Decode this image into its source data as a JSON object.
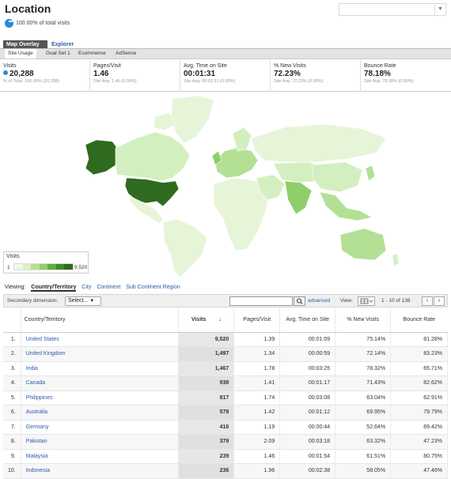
{
  "header": {
    "title": "Location",
    "subtitle": "100.00% of total visits"
  },
  "tabs": [
    {
      "label": "Map Overlay",
      "active": true
    },
    {
      "label": "Explorer",
      "active": false
    }
  ],
  "subtabs": [
    {
      "label": "Site Usage",
      "active": true
    },
    {
      "label": "Goal Set 1",
      "active": false
    },
    {
      "label": "Ecommerce",
      "active": false
    },
    {
      "label": "AdSense",
      "active": false
    }
  ],
  "metrics": [
    {
      "label": "Visits",
      "value": "20,288",
      "sub": "% of Total: 100.00% (20,288)"
    },
    {
      "label": "Pages/Visit",
      "value": "1.46",
      "sub": "Site Avg: 1.46 (0.00%)"
    },
    {
      "label": "Avg. Time on Site",
      "value": "00:01:31",
      "sub": "Site Avg: 00:01:31 (0.00%)"
    },
    {
      "label": "% New Visits",
      "value": "72.23%",
      "sub": "Site Avg: 72.23% (0.00%)"
    },
    {
      "label": "Bounce Rate",
      "value": "78.18%",
      "sub": "Site Avg: 78.18% (0.00%)"
    }
  ],
  "legend": {
    "title": "Visits",
    "min": "1",
    "max": "9,520"
  },
  "colors": {
    "map_dark": "#2e6b1e",
    "map_mid": "#8fcf6a",
    "map_light": "#d9f0c4",
    "map_pale": "#eef8e4",
    "link": "#2a5caa"
  },
  "viewing": {
    "label": "Viewing:",
    "options": [
      {
        "label": "Country/Territory",
        "active": true
      },
      {
        "label": "City",
        "active": false
      },
      {
        "label": "Continent",
        "active": false
      },
      {
        "label": "Sub Continent Region",
        "active": false
      }
    ]
  },
  "toolbar": {
    "secondary_label": "Secondary dimension:",
    "select_label": "Select...",
    "search_icon": "search-icon",
    "advanced": "advanced",
    "view_label": "View:",
    "range": "1 - 10 of 138",
    "prev": "‹",
    "next": "›"
  },
  "table": {
    "columns": [
      "Country/Territory",
      "Visits",
      "Pages/Visit",
      "Avg. Time on Site",
      "% New Visits",
      "Bounce Rate"
    ],
    "rows": [
      {
        "idx": "1.",
        "country": "United States",
        "visits": "9,520",
        "ppv": "1.39",
        "time": "00:01:09",
        "new": "75.14%",
        "bounce": "81.28%"
      },
      {
        "idx": "2.",
        "country": "United Kingdom",
        "visits": "1,497",
        "ppv": "1.34",
        "time": "00:00:59",
        "new": "72.14%",
        "bounce": "83.23%"
      },
      {
        "idx": "3.",
        "country": "India",
        "visits": "1,467",
        "ppv": "1.78",
        "time": "00:03:25",
        "new": "78.32%",
        "bounce": "65.71%"
      },
      {
        "idx": "4.",
        "country": "Canada",
        "visits": "938",
        "ppv": "1.41",
        "time": "00:01:17",
        "new": "71.43%",
        "bounce": "82.62%"
      },
      {
        "idx": "5.",
        "country": "Philippines",
        "visits": "817",
        "ppv": "1.74",
        "time": "00:03:08",
        "new": "63.04%",
        "bounce": "62.91%"
      },
      {
        "idx": "6.",
        "country": "Australia",
        "visits": "579",
        "ppv": "1.42",
        "time": "00:01:12",
        "new": "69.95%",
        "bounce": "79.79%"
      },
      {
        "idx": "7.",
        "country": "Germany",
        "visits": "416",
        "ppv": "1.19",
        "time": "00:00:44",
        "new": "52.64%",
        "bounce": "89.42%"
      },
      {
        "idx": "8.",
        "country": "Pakistan",
        "visits": "379",
        "ppv": "2.09",
        "time": "00:03:18",
        "new": "63.32%",
        "bounce": "47.23%"
      },
      {
        "idx": "9.",
        "country": "Malaysia",
        "visits": "239",
        "ppv": "1.46",
        "time": "00:01:54",
        "new": "61.51%",
        "bounce": "80.75%"
      },
      {
        "idx": "10.",
        "country": "Indonesia",
        "visits": "236",
        "ppv": "1.96",
        "time": "00:02:38",
        "new": "58.05%",
        "bounce": "47.46%"
      }
    ]
  }
}
